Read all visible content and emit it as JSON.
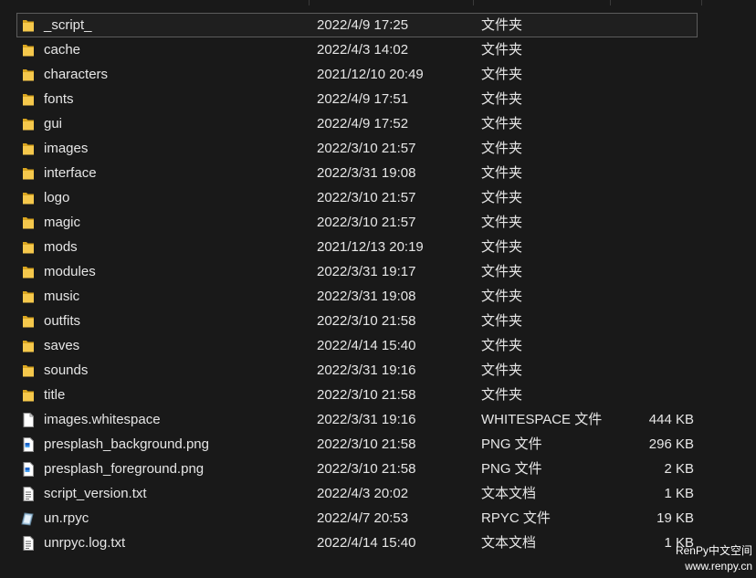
{
  "files": [
    {
      "name": "_script_",
      "date": "2022/4/9 17:25",
      "type": "文件夹",
      "size": "",
      "icon": "folder-icon",
      "selected": true
    },
    {
      "name": "cache",
      "date": "2022/4/3 14:02",
      "type": "文件夹",
      "size": "",
      "icon": "folder-icon"
    },
    {
      "name": "characters",
      "date": "2021/12/10 20:49",
      "type": "文件夹",
      "size": "",
      "icon": "folder-icon"
    },
    {
      "name": "fonts",
      "date": "2022/4/9 17:51",
      "type": "文件夹",
      "size": "",
      "icon": "folder-icon"
    },
    {
      "name": "gui",
      "date": "2022/4/9 17:52",
      "type": "文件夹",
      "size": "",
      "icon": "folder-icon"
    },
    {
      "name": "images",
      "date": "2022/3/10 21:57",
      "type": "文件夹",
      "size": "",
      "icon": "folder-icon"
    },
    {
      "name": "interface",
      "date": "2022/3/31 19:08",
      "type": "文件夹",
      "size": "",
      "icon": "folder-icon"
    },
    {
      "name": "logo",
      "date": "2022/3/10 21:57",
      "type": "文件夹",
      "size": "",
      "icon": "folder-icon"
    },
    {
      "name": "magic",
      "date": "2022/3/10 21:57",
      "type": "文件夹",
      "size": "",
      "icon": "folder-icon"
    },
    {
      "name": "mods",
      "date": "2021/12/13 20:19",
      "type": "文件夹",
      "size": "",
      "icon": "folder-icon"
    },
    {
      "name": "modules",
      "date": "2022/3/31 19:17",
      "type": "文件夹",
      "size": "",
      "icon": "folder-icon"
    },
    {
      "name": "music",
      "date": "2022/3/31 19:08",
      "type": "文件夹",
      "size": "",
      "icon": "folder-icon"
    },
    {
      "name": "outfits",
      "date": "2022/3/10 21:58",
      "type": "文件夹",
      "size": "",
      "icon": "folder-icon"
    },
    {
      "name": "saves",
      "date": "2022/4/14 15:40",
      "type": "文件夹",
      "size": "",
      "icon": "folder-icon"
    },
    {
      "name": "sounds",
      "date": "2022/3/31 19:16",
      "type": "文件夹",
      "size": "",
      "icon": "folder-icon"
    },
    {
      "name": "title",
      "date": "2022/3/10 21:58",
      "type": "文件夹",
      "size": "",
      "icon": "folder-icon"
    },
    {
      "name": "images.whitespace",
      "date": "2022/3/31 19:16",
      "type": "WHITESPACE 文件",
      "size": "444 KB",
      "icon": "blank-file-icon"
    },
    {
      "name": "presplash_background.png",
      "date": "2022/3/10 21:58",
      "type": "PNG 文件",
      "size": "296 KB",
      "icon": "image-file-icon"
    },
    {
      "name": "presplash_foreground.png",
      "date": "2022/3/10 21:58",
      "type": "PNG 文件",
      "size": "2 KB",
      "icon": "image-file-icon"
    },
    {
      "name": "script_version.txt",
      "date": "2022/4/3 20:02",
      "type": "文本文档",
      "size": "1 KB",
      "icon": "text-file-icon"
    },
    {
      "name": "un.rpyc",
      "date": "2022/4/7 20:53",
      "type": "RPYC 文件",
      "size": "19 KB",
      "icon": "rpyc-file-icon"
    },
    {
      "name": "unrpyc.log.txt",
      "date": "2022/4/14 15:40",
      "type": "文本文档",
      "size": "1 KB",
      "icon": "text-file-icon"
    }
  ],
  "watermark": {
    "line1": "RenPy中文空间",
    "line2": "www.renpy.cn"
  }
}
